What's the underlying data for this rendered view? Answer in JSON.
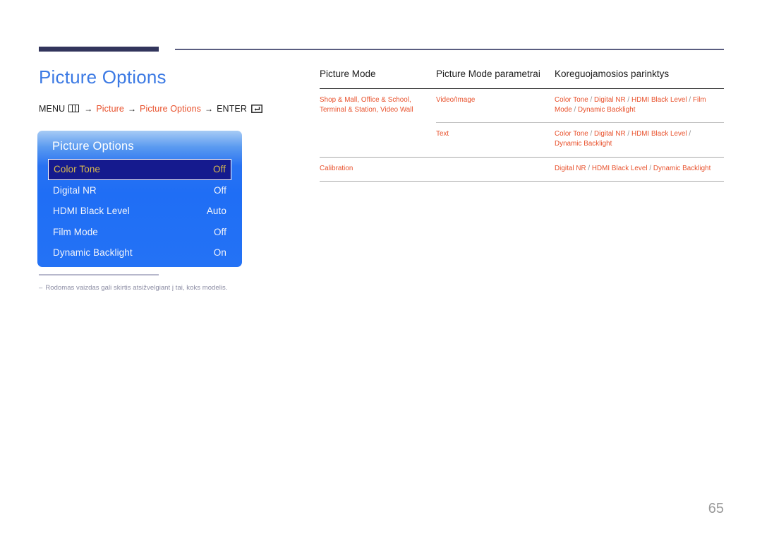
{
  "header": {
    "title": "Picture Options"
  },
  "breadcrumb": {
    "menu_label": "MENU",
    "menu_icon": "menu-grid-icon",
    "arrow": "→",
    "link1": "Picture",
    "link2": "Picture Options",
    "enter_label": "ENTER",
    "enter_icon": "enter-return-icon"
  },
  "osd": {
    "title": "Picture Options",
    "items": [
      {
        "label": "Color Tone",
        "value": "Off",
        "selected": true
      },
      {
        "label": "Digital NR",
        "value": "Off",
        "selected": false
      },
      {
        "label": "HDMI Black Level",
        "value": "Auto",
        "selected": false
      },
      {
        "label": "Film Mode",
        "value": "Off",
        "selected": false
      },
      {
        "label": "Dynamic Backlight",
        "value": "On",
        "selected": false
      }
    ]
  },
  "note": {
    "dash": "–",
    "text": "Rodomas vaizdas gali skirtis atsižvelgiant į tai, koks modelis."
  },
  "table": {
    "headers": [
      "Picture Mode",
      "Picture Mode parametrai",
      "Koreguojamosios parinktys"
    ],
    "rows": [
      {
        "mode": "Shop & Mall, Office & School, Terminal & Station, Video Wall",
        "parameter": "Video/Image",
        "options": "Color Tone / Digital NR / HDMI Black Level / Film Mode / Dynamic Backlight"
      },
      {
        "mode": "",
        "parameter": "Text",
        "options": "Color Tone / Digital NR / HDMI Black Level / Dynamic Backlight"
      },
      {
        "mode": "Calibration",
        "parameter": "",
        "options": "Digital NR / HDMI Black Level / Dynamic Backlight"
      }
    ]
  },
  "footer": {
    "page_number": "65"
  },
  "colors": {
    "title_blue": "#3c7ae4",
    "link_orange": "#e8502b",
    "rule_navy": "#32355c",
    "osd_blue": "#1f6ef5",
    "osd_selected_bg": "#151a8e",
    "osd_selected_text": "#d9b94e",
    "note_gray": "#8b8ca3",
    "page_number_gray": "#9a9a9a"
  }
}
